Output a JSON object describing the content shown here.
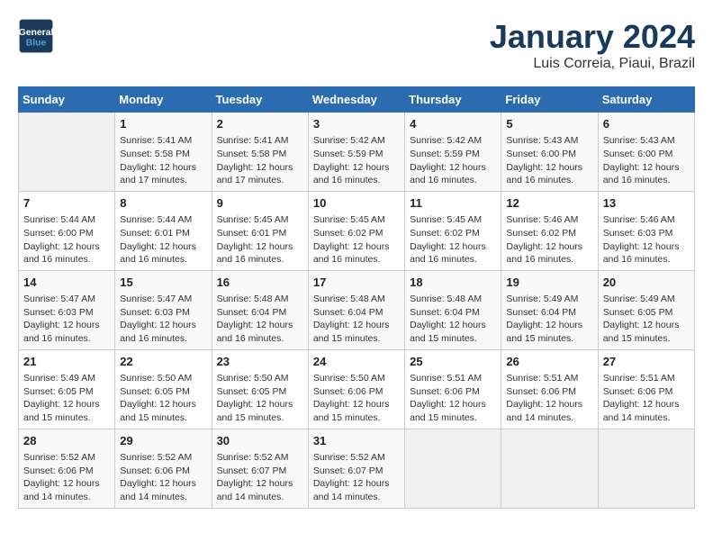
{
  "header": {
    "logo_line1": "General",
    "logo_line2": "Blue",
    "month": "January 2024",
    "location": "Luis Correia, Piaui, Brazil"
  },
  "weekdays": [
    "Sunday",
    "Monday",
    "Tuesday",
    "Wednesday",
    "Thursday",
    "Friday",
    "Saturday"
  ],
  "weeks": [
    [
      {
        "day": "",
        "info": ""
      },
      {
        "day": "1",
        "info": "Sunrise: 5:41 AM\nSunset: 5:58 PM\nDaylight: 12 hours\nand 17 minutes."
      },
      {
        "day": "2",
        "info": "Sunrise: 5:41 AM\nSunset: 5:58 PM\nDaylight: 12 hours\nand 17 minutes."
      },
      {
        "day": "3",
        "info": "Sunrise: 5:42 AM\nSunset: 5:59 PM\nDaylight: 12 hours\nand 16 minutes."
      },
      {
        "day": "4",
        "info": "Sunrise: 5:42 AM\nSunset: 5:59 PM\nDaylight: 12 hours\nand 16 minutes."
      },
      {
        "day": "5",
        "info": "Sunrise: 5:43 AM\nSunset: 6:00 PM\nDaylight: 12 hours\nand 16 minutes."
      },
      {
        "day": "6",
        "info": "Sunrise: 5:43 AM\nSunset: 6:00 PM\nDaylight: 12 hours\nand 16 minutes."
      }
    ],
    [
      {
        "day": "7",
        "info": "Sunrise: 5:44 AM\nSunset: 6:00 PM\nDaylight: 12 hours\nand 16 minutes."
      },
      {
        "day": "8",
        "info": "Sunrise: 5:44 AM\nSunset: 6:01 PM\nDaylight: 12 hours\nand 16 minutes."
      },
      {
        "day": "9",
        "info": "Sunrise: 5:45 AM\nSunset: 6:01 PM\nDaylight: 12 hours\nand 16 minutes."
      },
      {
        "day": "10",
        "info": "Sunrise: 5:45 AM\nSunset: 6:02 PM\nDaylight: 12 hours\nand 16 minutes."
      },
      {
        "day": "11",
        "info": "Sunrise: 5:45 AM\nSunset: 6:02 PM\nDaylight: 12 hours\nand 16 minutes."
      },
      {
        "day": "12",
        "info": "Sunrise: 5:46 AM\nSunset: 6:02 PM\nDaylight: 12 hours\nand 16 minutes."
      },
      {
        "day": "13",
        "info": "Sunrise: 5:46 AM\nSunset: 6:03 PM\nDaylight: 12 hours\nand 16 minutes."
      }
    ],
    [
      {
        "day": "14",
        "info": "Sunrise: 5:47 AM\nSunset: 6:03 PM\nDaylight: 12 hours\nand 16 minutes."
      },
      {
        "day": "15",
        "info": "Sunrise: 5:47 AM\nSunset: 6:03 PM\nDaylight: 12 hours\nand 16 minutes."
      },
      {
        "day": "16",
        "info": "Sunrise: 5:48 AM\nSunset: 6:04 PM\nDaylight: 12 hours\nand 16 minutes."
      },
      {
        "day": "17",
        "info": "Sunrise: 5:48 AM\nSunset: 6:04 PM\nDaylight: 12 hours\nand 15 minutes."
      },
      {
        "day": "18",
        "info": "Sunrise: 5:48 AM\nSunset: 6:04 PM\nDaylight: 12 hours\nand 15 minutes."
      },
      {
        "day": "19",
        "info": "Sunrise: 5:49 AM\nSunset: 6:04 PM\nDaylight: 12 hours\nand 15 minutes."
      },
      {
        "day": "20",
        "info": "Sunrise: 5:49 AM\nSunset: 6:05 PM\nDaylight: 12 hours\nand 15 minutes."
      }
    ],
    [
      {
        "day": "21",
        "info": "Sunrise: 5:49 AM\nSunset: 6:05 PM\nDaylight: 12 hours\nand 15 minutes."
      },
      {
        "day": "22",
        "info": "Sunrise: 5:50 AM\nSunset: 6:05 PM\nDaylight: 12 hours\nand 15 minutes."
      },
      {
        "day": "23",
        "info": "Sunrise: 5:50 AM\nSunset: 6:05 PM\nDaylight: 12 hours\nand 15 minutes."
      },
      {
        "day": "24",
        "info": "Sunrise: 5:50 AM\nSunset: 6:06 PM\nDaylight: 12 hours\nand 15 minutes."
      },
      {
        "day": "25",
        "info": "Sunrise: 5:51 AM\nSunset: 6:06 PM\nDaylight: 12 hours\nand 15 minutes."
      },
      {
        "day": "26",
        "info": "Sunrise: 5:51 AM\nSunset: 6:06 PM\nDaylight: 12 hours\nand 14 minutes."
      },
      {
        "day": "27",
        "info": "Sunrise: 5:51 AM\nSunset: 6:06 PM\nDaylight: 12 hours\nand 14 minutes."
      }
    ],
    [
      {
        "day": "28",
        "info": "Sunrise: 5:52 AM\nSunset: 6:06 PM\nDaylight: 12 hours\nand 14 minutes."
      },
      {
        "day": "29",
        "info": "Sunrise: 5:52 AM\nSunset: 6:06 PM\nDaylight: 12 hours\nand 14 minutes."
      },
      {
        "day": "30",
        "info": "Sunrise: 5:52 AM\nSunset: 6:07 PM\nDaylight: 12 hours\nand 14 minutes."
      },
      {
        "day": "31",
        "info": "Sunrise: 5:52 AM\nSunset: 6:07 PM\nDaylight: 12 hours\nand 14 minutes."
      },
      {
        "day": "",
        "info": ""
      },
      {
        "day": "",
        "info": ""
      },
      {
        "day": "",
        "info": ""
      }
    ]
  ]
}
